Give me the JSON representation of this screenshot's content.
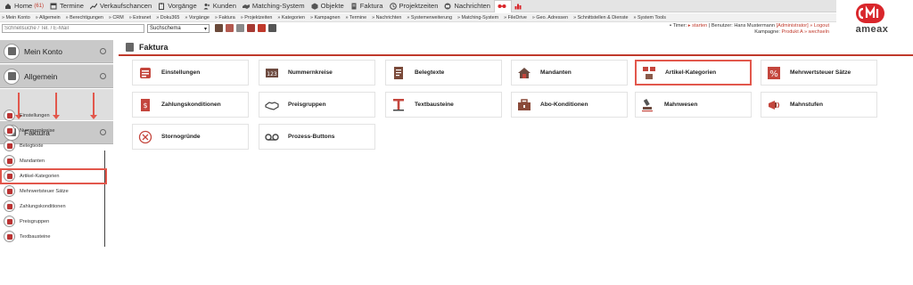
{
  "topnav": [
    {
      "label": "Home",
      "count": "(61)",
      "icon": "home-icon"
    },
    {
      "label": "Termine",
      "icon": "calendar-icon"
    },
    {
      "label": "Verkaufschancen",
      "icon": "chart-icon"
    },
    {
      "label": "Vorgänge",
      "icon": "clipboard-icon"
    },
    {
      "label": "Kunden",
      "icon": "users-icon"
    },
    {
      "label": "Matching-System",
      "icon": "handshake-icon"
    },
    {
      "label": "Objekte",
      "icon": "cube-icon"
    },
    {
      "label": "Faktura",
      "icon": "invoice-icon"
    },
    {
      "label": "Projektzeiten",
      "icon": "clock-icon"
    },
    {
      "label": "Nachrichten",
      "icon": "mail-icon"
    }
  ],
  "subnav": [
    "» Mein Konto",
    "» Allgemein",
    "» Berechtigungen",
    "» CRM",
    "» Extranet",
    "» Doku365",
    "» Vorgänge",
    "» Faktura",
    "» Projektzeiten",
    "» Kategorien",
    "» Kampagnen",
    "» Termine",
    "» Nachrichten",
    "» Systemerweiterung",
    "» Matching-System",
    "» FileDrive",
    "» Geo. Adressen",
    "» Schnittstellen & Dienste",
    "» System Tools"
  ],
  "search": {
    "placeholder": "Schnellsuche / Tel. / E-Mail",
    "schema": "Suchschema"
  },
  "timer": {
    "prefix": "Timer:",
    "start": "starten",
    "user_text": "| Benutzer: Hans Mustermann",
    "admin": "[Administrator]",
    "logout": "» Logout",
    "kampagne_label": "Kampagne:",
    "kampagne_value": "Produkt A",
    "wechseln": "» wechseln"
  },
  "logo": {
    "text": "ameax"
  },
  "sidebar": {
    "sections": [
      "Mein Konto",
      "Allgemein",
      "Faktura"
    ],
    "items": [
      "Einstellungen",
      "Nummernkreise",
      "Belegtexte",
      "Mandanten",
      "Artikel-Kategorien",
      "Mehrwertsteuer Sätze",
      "Zahlungskonditionen",
      "Preisgruppen",
      "Textbausteine"
    ]
  },
  "main": {
    "title": "Faktura",
    "tiles": [
      [
        "Einstellungen",
        "Nummernkreise",
        "Belegtexte",
        "Mandanten",
        "Artikel-Kategorien",
        "Mehrwertsteuer Sätze"
      ],
      [
        "Zahlungskonditionen",
        "Preisgruppen",
        "Textbausteine",
        "Abo-Konditionen",
        "Mahnwesen",
        "Mahnstufen"
      ],
      [
        "Stornogründe",
        "Prozess-Buttons"
      ]
    ]
  },
  "colors": {
    "accent": "#e2574c",
    "brand": "#d9262b",
    "divider": "#c0392b"
  }
}
